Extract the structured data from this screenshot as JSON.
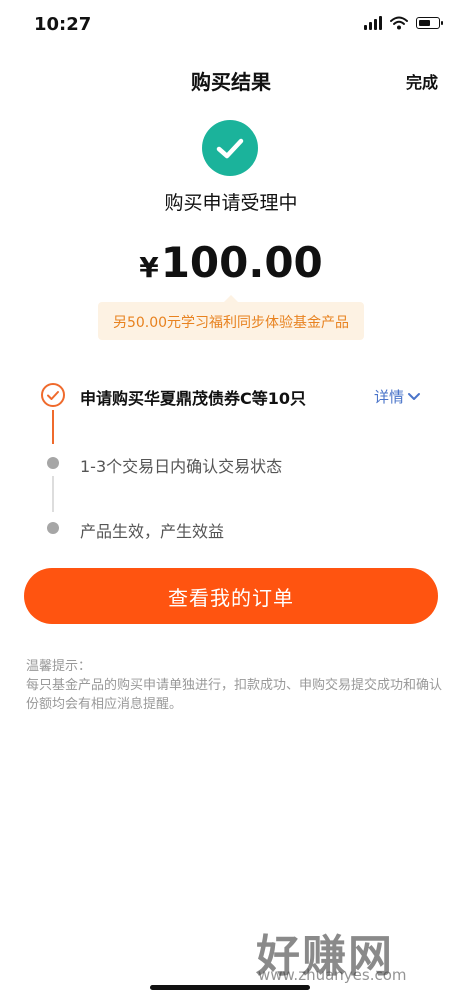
{
  "status_bar": {
    "time": "10:27"
  },
  "nav": {
    "title": "购买结果",
    "done_label": "完成"
  },
  "result": {
    "status_title": "购买申请受理中",
    "currency": "¥",
    "amount": "100.00",
    "bonus_text": "另50.00元学习福利同步体验基金产品"
  },
  "steps": [
    {
      "text": "申请购买华夏鼎茂债券C等10只",
      "state": "active"
    },
    {
      "text": "1-3个交易日内确认交易状态",
      "state": "pending"
    },
    {
      "text": "产品生效，产生效益",
      "state": "pending"
    }
  ],
  "detail_label": "详情",
  "order_button_label": "查看我的订单",
  "tip": {
    "title": "温馨提示：",
    "body": "每只基金产品的购买申请单独进行，扣款成功、申购交易提交成功和确认份额均会有相应消息提醒。"
  },
  "watermark": {
    "text": "好赚网",
    "url": "www.zhuanyes.com"
  },
  "colors": {
    "accent": "#ff5410",
    "success": "#1bb39b",
    "bonus_text": "#e8821f",
    "bonus_bg": "#fdf2e3",
    "link": "#4a74c9",
    "step_active": "#ef6a2c"
  }
}
